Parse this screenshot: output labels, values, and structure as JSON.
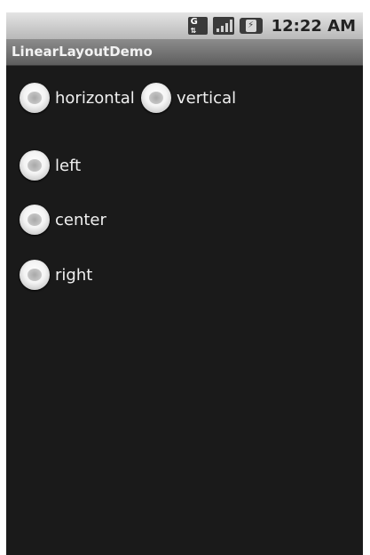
{
  "status_bar": {
    "icons": [
      "gsm-data-icon",
      "signal-icon",
      "battery-charging-icon"
    ],
    "gsm_letter": "G",
    "time": "12:22 AM"
  },
  "app": {
    "title": "LinearLayoutDemo"
  },
  "orientation_group": {
    "options": [
      {
        "label": "horizontal",
        "checked": false
      },
      {
        "label": "vertical",
        "checked": false
      }
    ]
  },
  "gravity_group": {
    "options": [
      {
        "label": "left",
        "checked": false
      },
      {
        "label": "center",
        "checked": false
      },
      {
        "label": "right",
        "checked": false
      }
    ]
  },
  "colors": {
    "background": "#1a1a1a",
    "text": "#f0f0f0",
    "title_bar": "#7a7a7a",
    "status_bar": "#cfcfcf"
  }
}
